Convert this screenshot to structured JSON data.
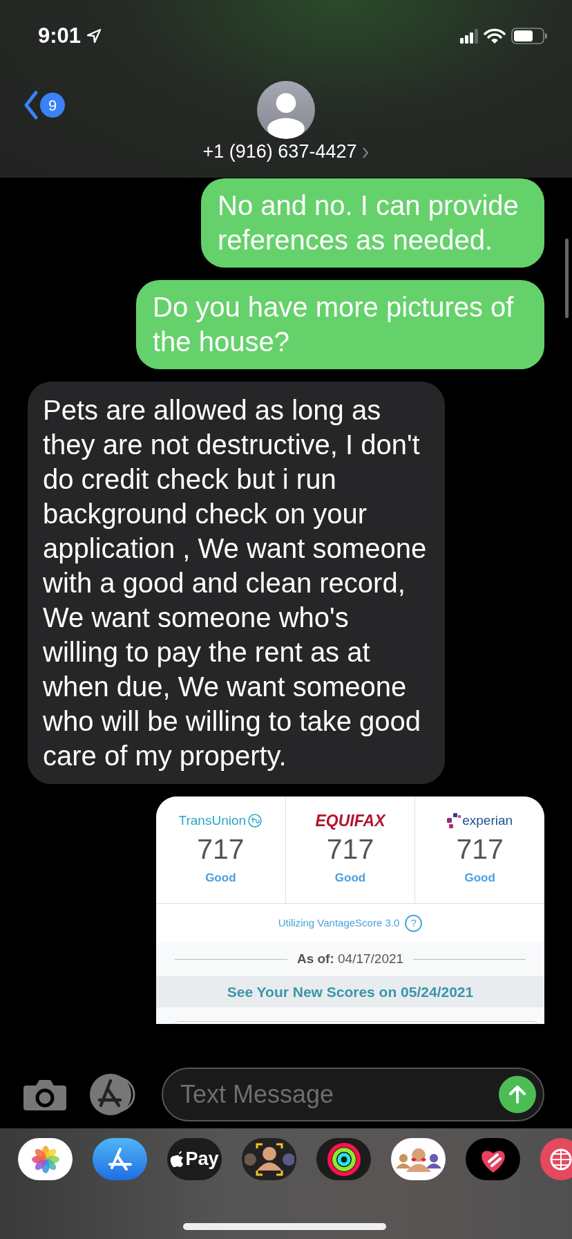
{
  "status_bar": {
    "time": "9:01"
  },
  "header": {
    "back_badge": "9",
    "contact": "+1 (916) 637-4427"
  },
  "messages": [
    {
      "kind": "sent",
      "text": "No and no. I can provide references as needed."
    },
    {
      "kind": "sent",
      "text": "Do you have more pictures of the house?"
    },
    {
      "kind": "received",
      "text": "Pets are allowed as long as they are not destructive, I don't do credit check but i run background check on your application , We want someone with a good and clean record, We want someone who's willing to pay the rent as at when due, We want someone who will be willing to take good care of my property."
    }
  ],
  "attachment": {
    "bureaus": [
      {
        "kind": "transunion",
        "name": "TransUnion",
        "score": "717",
        "rating": "Good"
      },
      {
        "kind": "equifax",
        "name": "EQUIFAX",
        "score": "717",
        "rating": "Good"
      },
      {
        "kind": "experian",
        "name": "experian",
        "score": "717",
        "rating": "Good"
      }
    ],
    "model_note": "Utilizing VantageScore 3.0",
    "help": "?",
    "as_of": "**As of:** 04/17/2021",
    "next_scores": "See Your New Scores on 05/24/2021"
  },
  "composer": {
    "placeholder": "Text Message"
  },
  "app_drawer": [
    {
      "kind": "photos"
    },
    {
      "kind": "appstore"
    },
    {
      "kind": "applepay",
      "label": "Pay"
    },
    {
      "kind": "memoji"
    },
    {
      "kind": "activity"
    },
    {
      "kind": "stickers"
    },
    {
      "kind": "touch"
    },
    {
      "kind": "web"
    }
  ]
}
